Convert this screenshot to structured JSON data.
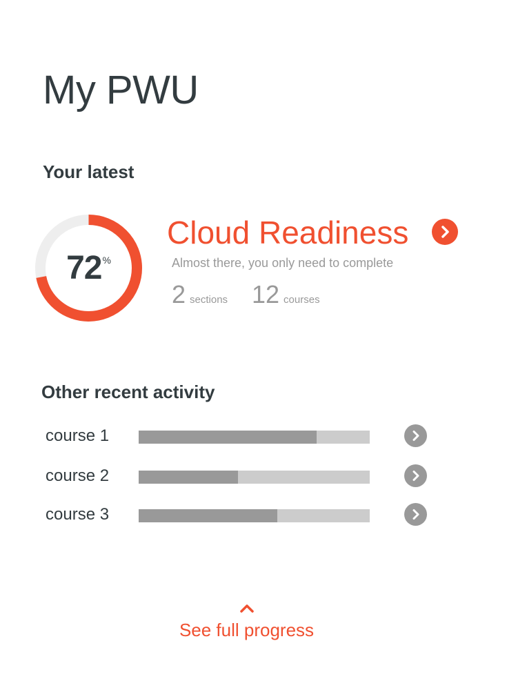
{
  "page": {
    "title": "My PWU"
  },
  "latest": {
    "heading": "Your latest",
    "progress": {
      "value": "72",
      "unit": "%",
      "fraction": 0.72
    },
    "course_title": "Cloud Readiness",
    "subtitle": "Almost there, you only need to complete",
    "stats": [
      {
        "value": "2",
        "label": "sections"
      },
      {
        "value": "12",
        "label": "courses"
      }
    ],
    "open_icon": "chevron-right-icon"
  },
  "activity": {
    "heading": "Other recent activity",
    "items": [
      {
        "label": "course 1",
        "progress": 0.77,
        "icon": "chevron-right-icon"
      },
      {
        "label": "course 2",
        "progress": 0.43,
        "icon": "chevron-right-icon"
      },
      {
        "label": "course 3",
        "progress": 0.6,
        "icon": "chevron-right-icon"
      }
    ]
  },
  "footer": {
    "label": "See full progress",
    "icon": "chevron-up-icon"
  },
  "colors": {
    "accent": "#f05030",
    "text_dark": "#333c40",
    "text_muted": "#999999",
    "track": "#cccccc",
    "ring_track": "#eeeeee"
  }
}
